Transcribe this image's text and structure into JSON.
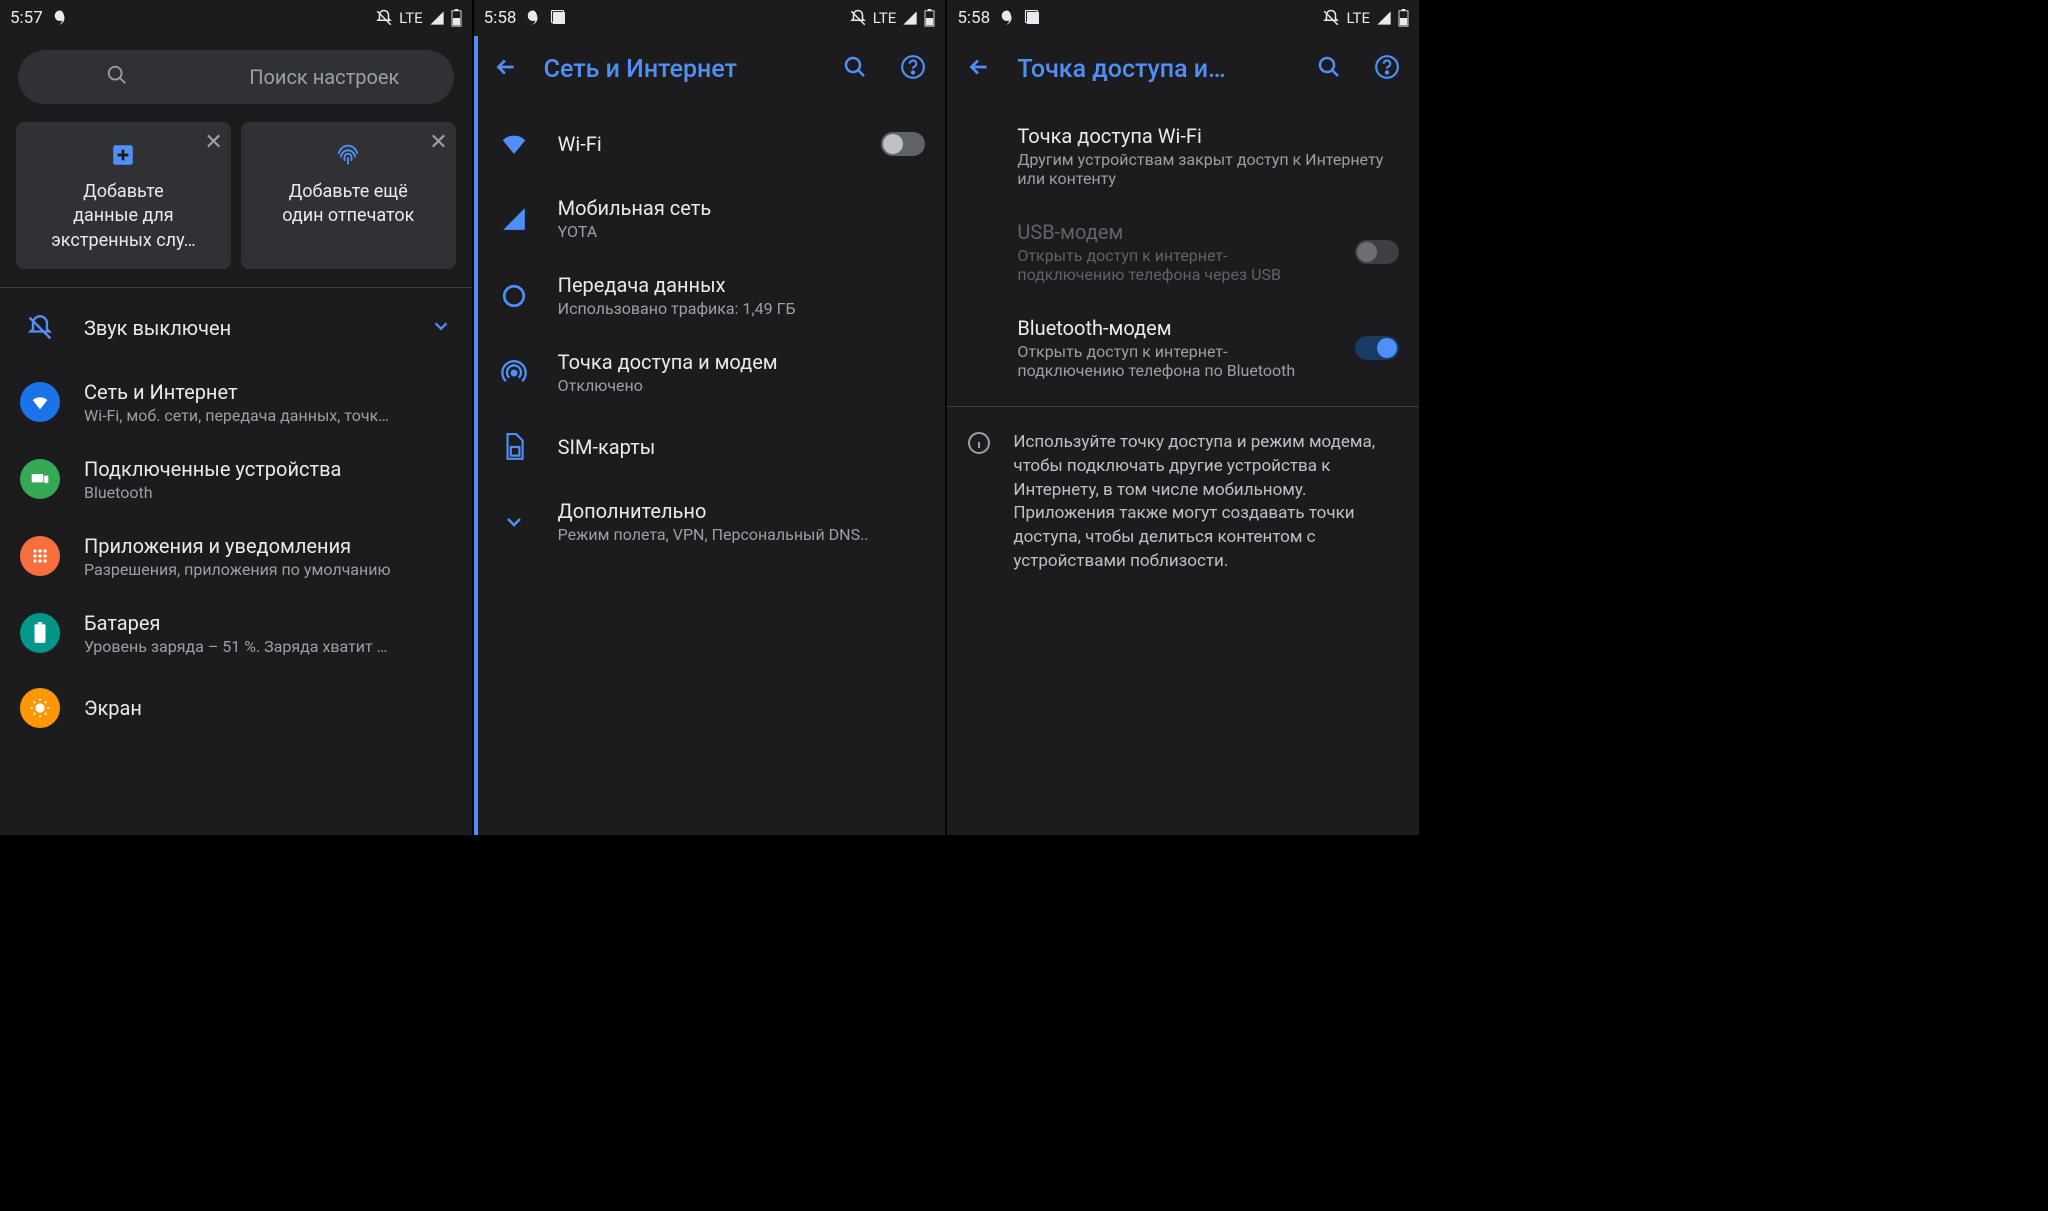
{
  "status": {
    "time1": "5:57",
    "time2": "5:58",
    "net": "LTE"
  },
  "screen1": {
    "search_placeholder": "Поиск настроек",
    "cards": [
      {
        "icon": "plus",
        "text": "Добавьте\nданные для\nэкстренных слу…"
      },
      {
        "icon": "fingerprint",
        "text": "Добавьте ещё\nодин отпечаток"
      }
    ],
    "sound_row": "Звук выключен",
    "items": [
      {
        "title": "Сеть и Интернет",
        "sub": "Wi-Fi, моб. сети, передача данных, точк…",
        "icon": "wifi",
        "color": "#1a73e8"
      },
      {
        "title": "Подключенные устройства",
        "sub": "Bluetooth",
        "icon": "devices",
        "color": "#34a853"
      },
      {
        "title": "Приложения и уведомления",
        "sub": "Разрешения, приложения по умолчанию",
        "icon": "apps",
        "color": "#f9703e"
      },
      {
        "title": "Батарея",
        "sub": "Уровень заряда – 51 %. Заряда хватит …",
        "icon": "battery",
        "color": "#009688"
      },
      {
        "title": "Экран",
        "sub": "",
        "icon": "display",
        "color": "#ff9800"
      }
    ]
  },
  "screen2": {
    "title": "Сеть и Интернет",
    "items": [
      {
        "title": "Wi-Fi",
        "sub": "",
        "icon": "wifi-solid",
        "toggle": "off"
      },
      {
        "title": "Мобильная сеть",
        "sub": "YOTA",
        "icon": "signal"
      },
      {
        "title": "Передача данных",
        "sub": "Использовано трафика: 1,49 ГБ",
        "icon": "data"
      },
      {
        "title": "Точка доступа и модем",
        "sub": "Отключено",
        "icon": "hotspot"
      },
      {
        "title": "SIM-карты",
        "sub": "",
        "icon": "sim"
      },
      {
        "title": "Дополнительно",
        "sub": "Режим полета, VPN, Персональный DNS..",
        "icon": "expand"
      }
    ]
  },
  "screen3": {
    "title": "Точка доступа и…",
    "items": [
      {
        "title": "Точка доступа Wi-Fi",
        "sub": "Другим устройствам закрыт доступ к Интернету или контенту"
      },
      {
        "title": "USB-модем",
        "sub": "Открыть доступ к интернет-подключению телефона через USB",
        "toggle": "off",
        "disabled": true
      },
      {
        "title": "Bluetooth-модем",
        "sub": "Открыть доступ к интернет-подключению телефона по Bluetooth",
        "toggle": "on"
      }
    ],
    "info": "Используйте точку доступа и режим модема, чтобы подключать другие устройства к Интернету, в том числе мобильному. Приложения также могут создавать точки доступа, чтобы делиться контентом с устройствами поблизости."
  }
}
